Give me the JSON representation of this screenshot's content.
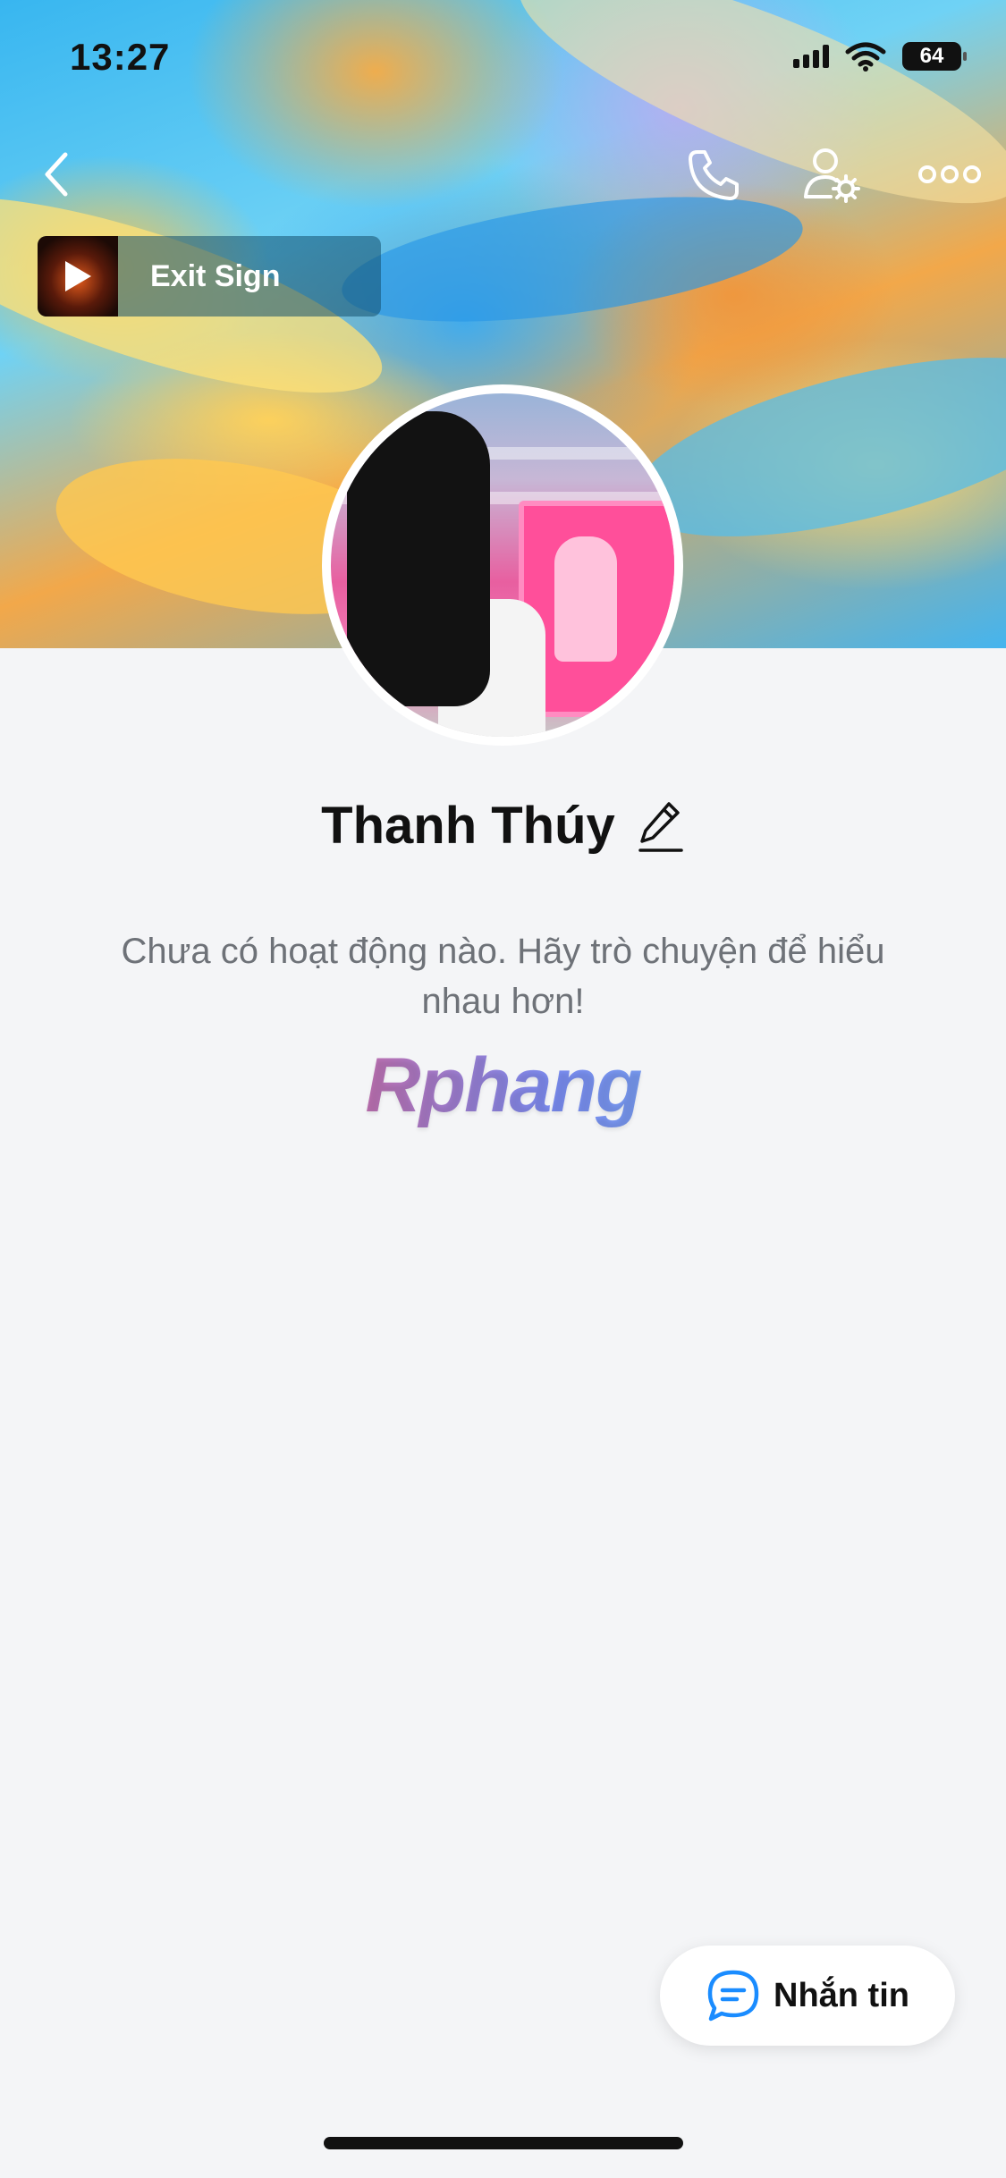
{
  "status_bar": {
    "time": "13:27",
    "battery": "64",
    "icons": [
      "signal-icon",
      "wifi-icon",
      "battery-icon"
    ]
  },
  "header": {
    "icons": [
      "back-icon",
      "phone-icon",
      "user-settings-icon",
      "more-icon"
    ]
  },
  "music": {
    "title": "Exit Sign",
    "icon": "play-icon"
  },
  "profile": {
    "name": "Thanh Thúy",
    "edit_icon": "pencil-icon"
  },
  "activity": {
    "empty_message": "Chưa có hoạt động nào. Hãy trò chuyện để hiểu nhau hơn!"
  },
  "watermark": {
    "text": "Rphang"
  },
  "message_button": {
    "label": "Nhắn tin",
    "icon": "chat-bubble-icon"
  },
  "colors": {
    "accent": "#1a8cff",
    "background": "#f4f5f7"
  }
}
